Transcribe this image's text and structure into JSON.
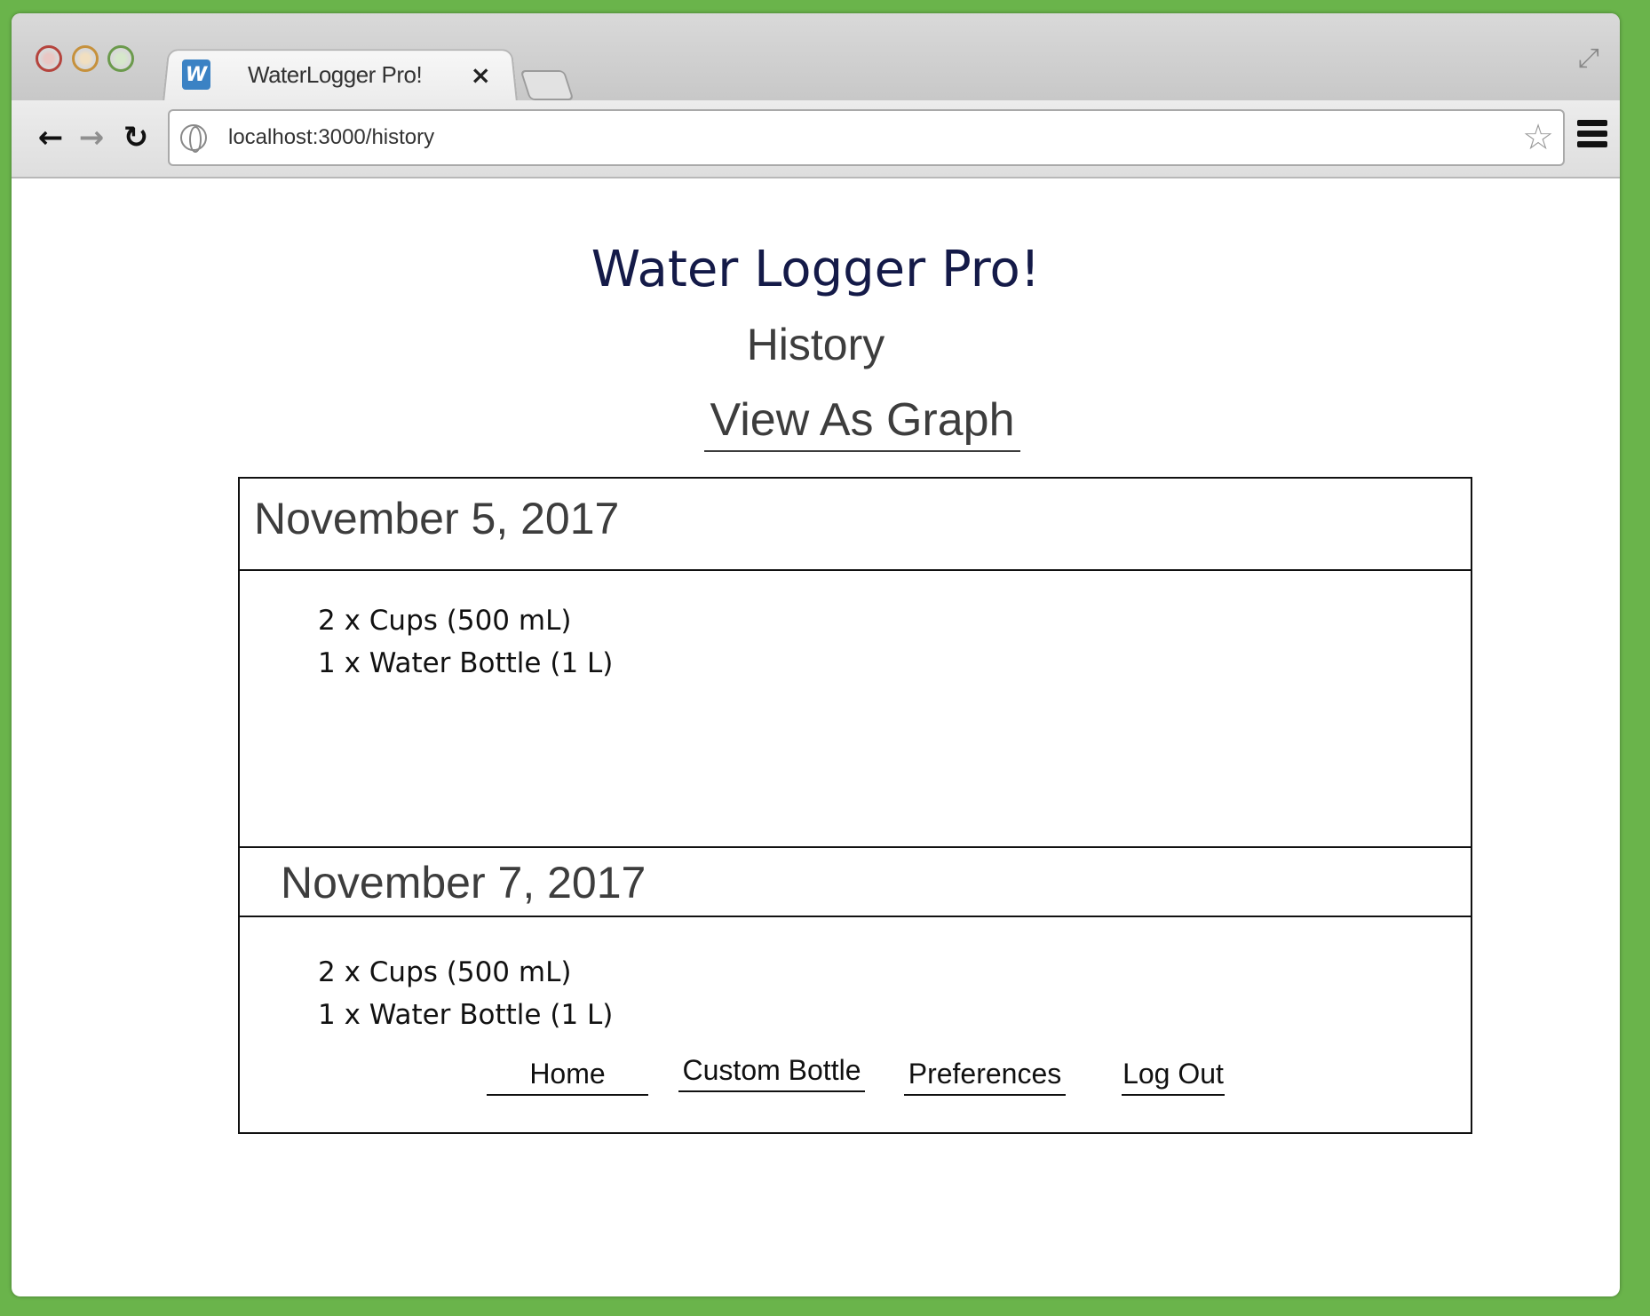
{
  "browser": {
    "tab_title": "WaterLogger Pro!",
    "tab_favicon": "W",
    "url": "localhost:3000/history"
  },
  "header": {
    "app_title": "Water Logger Pro!",
    "subtitle": "History",
    "view_graph_link": "View As Graph"
  },
  "history": [
    {
      "date": "November 5, 2017",
      "entries": [
        "2 x Cups (500 mL)",
        "1 x Water Bottle (1 L)"
      ]
    },
    {
      "date": "November 7, 2017",
      "entries": [
        "2 x Cups (500 mL)",
        "1 x Water Bottle (1 L)"
      ]
    }
  ],
  "footer_nav": {
    "home": "Home",
    "custom_bottle": "Custom Bottle",
    "preferences": "Preferences",
    "logout": "Log Out"
  },
  "colors": {
    "background": "#6ab44b",
    "title": "#141a48",
    "text": "#3d3d3d"
  }
}
